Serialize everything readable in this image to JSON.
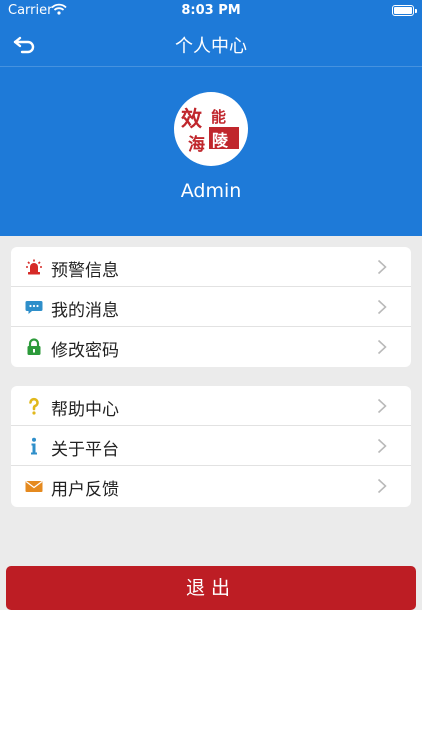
{
  "status_bar": {
    "carrier": "Carrier",
    "time": "8:03 PM"
  },
  "nav": {
    "title": "个人中心"
  },
  "profile": {
    "username": "Admin",
    "logo_text": "效能海陵"
  },
  "menu_groups": [
    {
      "items": [
        {
          "label": "预警信息",
          "icon": "alarm-icon"
        },
        {
          "label": "我的消息",
          "icon": "message-icon"
        },
        {
          "label": "修改密码",
          "icon": "lock-icon"
        }
      ]
    },
    {
      "items": [
        {
          "label": "帮助中心",
          "icon": "help-icon"
        },
        {
          "label": "关于平台",
          "icon": "info-icon"
        },
        {
          "label": "用户反馈",
          "icon": "mail-icon"
        }
      ]
    }
  ],
  "logout_label": "退出",
  "colors": {
    "header_blue": "#1e7ad8",
    "logout_red": "#bd1d24",
    "background_gray": "#ebebeb"
  }
}
